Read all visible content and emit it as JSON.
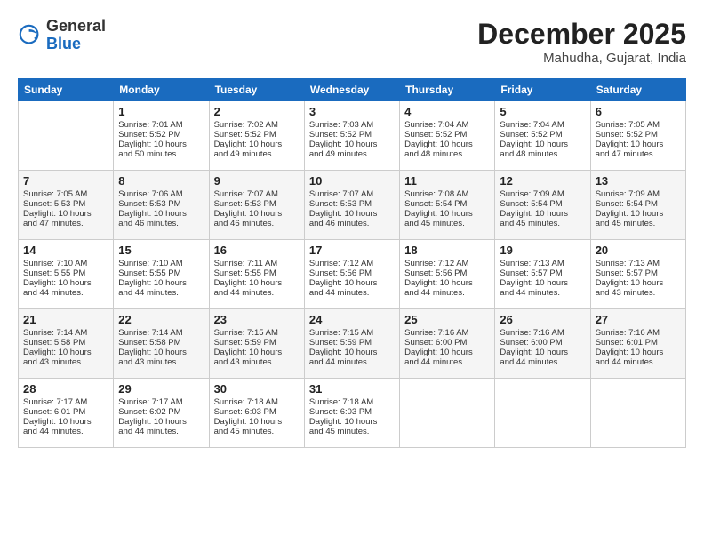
{
  "logo": {
    "general": "General",
    "blue": "Blue"
  },
  "title": {
    "month": "December 2025",
    "location": "Mahudha, Gujarat, India"
  },
  "headers": [
    "Sunday",
    "Monday",
    "Tuesday",
    "Wednesday",
    "Thursday",
    "Friday",
    "Saturday"
  ],
  "weeks": [
    [
      {
        "day": "",
        "info": ""
      },
      {
        "day": "1",
        "info": "Sunrise: 7:01 AM\nSunset: 5:52 PM\nDaylight: 10 hours\nand 50 minutes."
      },
      {
        "day": "2",
        "info": "Sunrise: 7:02 AM\nSunset: 5:52 PM\nDaylight: 10 hours\nand 49 minutes."
      },
      {
        "day": "3",
        "info": "Sunrise: 7:03 AM\nSunset: 5:52 PM\nDaylight: 10 hours\nand 49 minutes."
      },
      {
        "day": "4",
        "info": "Sunrise: 7:04 AM\nSunset: 5:52 PM\nDaylight: 10 hours\nand 48 minutes."
      },
      {
        "day": "5",
        "info": "Sunrise: 7:04 AM\nSunset: 5:52 PM\nDaylight: 10 hours\nand 48 minutes."
      },
      {
        "day": "6",
        "info": "Sunrise: 7:05 AM\nSunset: 5:52 PM\nDaylight: 10 hours\nand 47 minutes."
      }
    ],
    [
      {
        "day": "7",
        "info": "Sunrise: 7:05 AM\nSunset: 5:53 PM\nDaylight: 10 hours\nand 47 minutes."
      },
      {
        "day": "8",
        "info": "Sunrise: 7:06 AM\nSunset: 5:53 PM\nDaylight: 10 hours\nand 46 minutes."
      },
      {
        "day": "9",
        "info": "Sunrise: 7:07 AM\nSunset: 5:53 PM\nDaylight: 10 hours\nand 46 minutes."
      },
      {
        "day": "10",
        "info": "Sunrise: 7:07 AM\nSunset: 5:53 PM\nDaylight: 10 hours\nand 46 minutes."
      },
      {
        "day": "11",
        "info": "Sunrise: 7:08 AM\nSunset: 5:54 PM\nDaylight: 10 hours\nand 45 minutes."
      },
      {
        "day": "12",
        "info": "Sunrise: 7:09 AM\nSunset: 5:54 PM\nDaylight: 10 hours\nand 45 minutes."
      },
      {
        "day": "13",
        "info": "Sunrise: 7:09 AM\nSunset: 5:54 PM\nDaylight: 10 hours\nand 45 minutes."
      }
    ],
    [
      {
        "day": "14",
        "info": "Sunrise: 7:10 AM\nSunset: 5:55 PM\nDaylight: 10 hours\nand 44 minutes."
      },
      {
        "day": "15",
        "info": "Sunrise: 7:10 AM\nSunset: 5:55 PM\nDaylight: 10 hours\nand 44 minutes."
      },
      {
        "day": "16",
        "info": "Sunrise: 7:11 AM\nSunset: 5:55 PM\nDaylight: 10 hours\nand 44 minutes."
      },
      {
        "day": "17",
        "info": "Sunrise: 7:12 AM\nSunset: 5:56 PM\nDaylight: 10 hours\nand 44 minutes."
      },
      {
        "day": "18",
        "info": "Sunrise: 7:12 AM\nSunset: 5:56 PM\nDaylight: 10 hours\nand 44 minutes."
      },
      {
        "day": "19",
        "info": "Sunrise: 7:13 AM\nSunset: 5:57 PM\nDaylight: 10 hours\nand 44 minutes."
      },
      {
        "day": "20",
        "info": "Sunrise: 7:13 AM\nSunset: 5:57 PM\nDaylight: 10 hours\nand 43 minutes."
      }
    ],
    [
      {
        "day": "21",
        "info": "Sunrise: 7:14 AM\nSunset: 5:58 PM\nDaylight: 10 hours\nand 43 minutes."
      },
      {
        "day": "22",
        "info": "Sunrise: 7:14 AM\nSunset: 5:58 PM\nDaylight: 10 hours\nand 43 minutes."
      },
      {
        "day": "23",
        "info": "Sunrise: 7:15 AM\nSunset: 5:59 PM\nDaylight: 10 hours\nand 43 minutes."
      },
      {
        "day": "24",
        "info": "Sunrise: 7:15 AM\nSunset: 5:59 PM\nDaylight: 10 hours\nand 44 minutes."
      },
      {
        "day": "25",
        "info": "Sunrise: 7:16 AM\nSunset: 6:00 PM\nDaylight: 10 hours\nand 44 minutes."
      },
      {
        "day": "26",
        "info": "Sunrise: 7:16 AM\nSunset: 6:00 PM\nDaylight: 10 hours\nand 44 minutes."
      },
      {
        "day": "27",
        "info": "Sunrise: 7:16 AM\nSunset: 6:01 PM\nDaylight: 10 hours\nand 44 minutes."
      }
    ],
    [
      {
        "day": "28",
        "info": "Sunrise: 7:17 AM\nSunset: 6:01 PM\nDaylight: 10 hours\nand 44 minutes."
      },
      {
        "day": "29",
        "info": "Sunrise: 7:17 AM\nSunset: 6:02 PM\nDaylight: 10 hours\nand 44 minutes."
      },
      {
        "day": "30",
        "info": "Sunrise: 7:18 AM\nSunset: 6:03 PM\nDaylight: 10 hours\nand 45 minutes."
      },
      {
        "day": "31",
        "info": "Sunrise: 7:18 AM\nSunset: 6:03 PM\nDaylight: 10 hours\nand 45 minutes."
      },
      {
        "day": "",
        "info": ""
      },
      {
        "day": "",
        "info": ""
      },
      {
        "day": "",
        "info": ""
      }
    ]
  ]
}
